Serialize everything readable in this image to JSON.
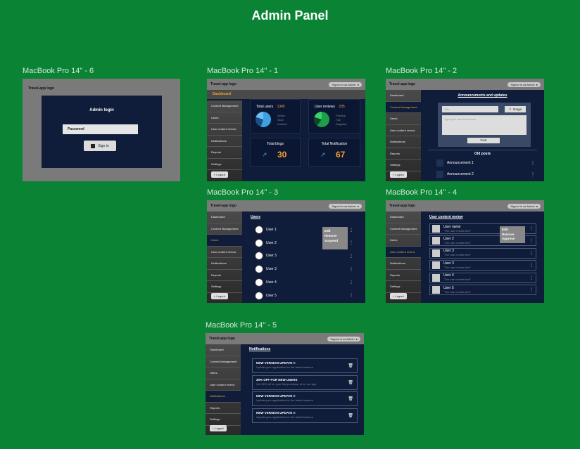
{
  "title": "Admin Panel",
  "common": {
    "logo": "Travel-app logo",
    "signed_in": "Signed in as Admin",
    "logout": "Logout",
    "sidebar": [
      "Dashboard",
      "Content Management",
      "Users",
      "User content review",
      "Notifications",
      "Reports",
      "Settings"
    ]
  },
  "login": {
    "label": "MacBook Pro 14\" - 6",
    "logo": "Travel-app logo",
    "heading": "Admin login",
    "password_placeholder": "Password",
    "signin": "Sign in"
  },
  "dashboard": {
    "label": "MacBook Pro 14\" - 1",
    "heading": "Dashboard",
    "total_users_label": "Total users",
    "total_users": "1345",
    "users_legend": [
      "Active",
      "Slow",
      "Inactive"
    ],
    "user_reviews_label": "User reviews",
    "user_reviews": "205",
    "reviews_legend": [
      "Positive",
      "Fair",
      "Negative"
    ],
    "blogs_label": "Total blogs",
    "blogs": "30",
    "notif_label": "Total Notification",
    "notif": "67",
    "colors": {
      "accent": "#f0a030",
      "pie_users": "#3fa0e0",
      "pie_reviews": "#1aa04a"
    }
  },
  "content": {
    "label": "MacBook Pro 14\" - 2",
    "heading": "Announcements and updates",
    "title_placeholder": "Title",
    "image_btn": "Image",
    "ann_placeholder": "Type your announcement",
    "post": "Post",
    "old_posts": "Old posts",
    "posts": [
      "Announcement 1",
      "Announcement 2"
    ]
  },
  "users": {
    "label": "MacBook Pro 14\" - 3",
    "heading": "Users",
    "list": [
      "User 1",
      "User 2",
      "User 3",
      "User 3",
      "User 4",
      "User 5"
    ],
    "menu": [
      "Edit",
      "Remove",
      "Suspend"
    ]
  },
  "review": {
    "label": "MacBook Pro 14\" - 4",
    "heading": "User content review",
    "review_text": "\"The user review text\"",
    "list": [
      "User name",
      "User 2",
      "User 3",
      "User 3",
      "User 4",
      "User 5"
    ],
    "menu": [
      "Edit",
      "Remove",
      "Approve"
    ]
  },
  "notifications": {
    "label": "MacBook Pro 14\" - 5",
    "heading": "Notifications",
    "items": [
      {
        "title": "NEW VERSION UPDATE !!",
        "body": "Update your application for the latest features"
      },
      {
        "title": "30% OFF FOR NEW USERS",
        "body": "Get 30% off on your first purchase of on our app"
      },
      {
        "title": "NEW VERSION UPDATE !!",
        "body": "Update your application for the latest features"
      },
      {
        "title": "NEW VERSION UPDATE !!",
        "body": "Update your application for the latest features"
      }
    ]
  }
}
